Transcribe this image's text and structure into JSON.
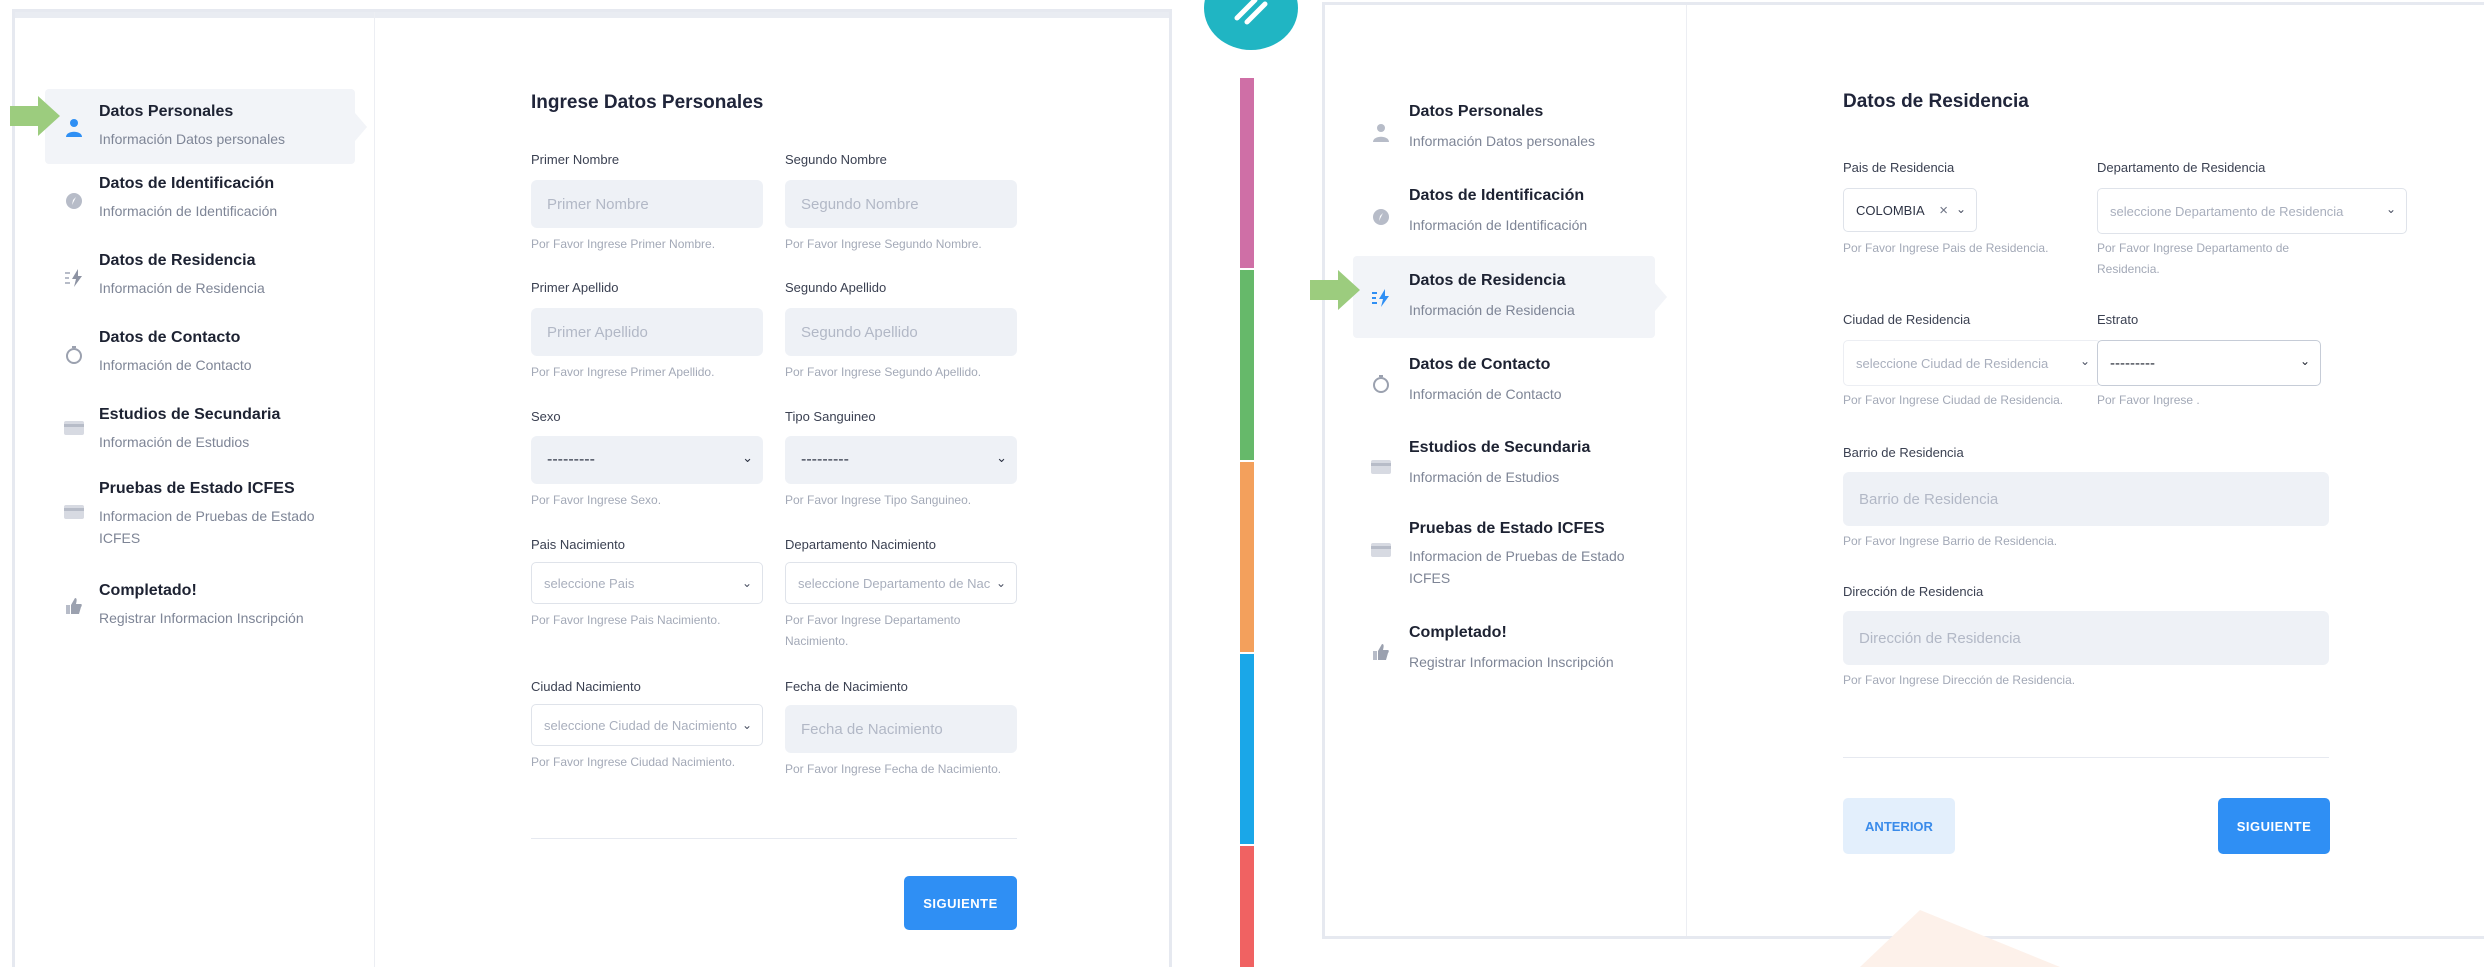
{
  "steps": [
    {
      "title": "Datos Personales",
      "sub": "Información Datos personales",
      "icon": "user-icon"
    },
    {
      "title": "Datos de Identificación",
      "sub": "Información de Identificación",
      "icon": "compass-icon"
    },
    {
      "title": "Datos de Residencia",
      "sub": "Información de Residencia",
      "icon": "bolt-icon"
    },
    {
      "title": "Datos de Contacto",
      "sub": "Información de Contacto",
      "icon": "clock-icon"
    },
    {
      "title": "Estudios de Secundaria",
      "sub": "Información de Estudios",
      "icon": "card-icon"
    },
    {
      "title": "Pruebas de Estado ICFES",
      "sub": "Informacion de Pruebas de Estado ICFES",
      "sub_right_1": "Informacion de Pruebas de Estado",
      "sub_right_2": "ICFES",
      "sub_left_1": "Informacion de Pruebas de Estado",
      "sub_left_2": "ICFES",
      "icon": "card-icon"
    },
    {
      "title": "Completado!",
      "sub": "Registrar Informacion Inscripción",
      "icon": "thumbs-up-icon"
    }
  ],
  "left_form": {
    "title": "Ingrese Datos Personales",
    "primer_nombre": {
      "label": "Primer Nombre",
      "placeholder": "Primer Nombre",
      "hint": "Por Favor Ingrese Primer Nombre."
    },
    "segundo_nombre": {
      "label": "Segundo Nombre",
      "placeholder": "Segundo Nombre",
      "hint": "Por Favor Ingrese Segundo Nombre."
    },
    "primer_apellido": {
      "label": "Primer Apellido",
      "placeholder": "Primer Apellido",
      "hint": "Por Favor Ingrese Primer Apellido."
    },
    "segundo_apellido": {
      "label": "Segundo Apellido",
      "placeholder": "Segundo Apellido",
      "hint": "Por Favor Ingrese Segundo Apellido."
    },
    "sexo": {
      "label": "Sexo",
      "value": "---------",
      "hint": "Por Favor Ingrese Sexo."
    },
    "tipo_sanguineo": {
      "label": "Tipo Sanguineo",
      "value": "---------",
      "hint": "Por Favor Ingrese Tipo Sanguineo."
    },
    "pais_nacimiento": {
      "label": "Pais Nacimiento",
      "value": "seleccione Pais",
      "hint": "Por Favor Ingrese Pais Nacimiento."
    },
    "depto_nacimiento": {
      "label": "Departamento Nacimiento",
      "value": "seleccione Departamento de Nac",
      "hint_1": "Por Favor Ingrese Departamento",
      "hint_2": "Nacimiento."
    },
    "ciudad_nacimiento": {
      "label": "Ciudad Nacimiento",
      "value": "seleccione Ciudad de Nacimiento",
      "hint": "Por Favor Ingrese Ciudad Nacimiento."
    },
    "fecha_nacimiento": {
      "label": "Fecha de Nacimiento",
      "placeholder": "Fecha de Nacimiento",
      "hint": "Por Favor Ingrese Fecha de Nacimiento."
    },
    "next_label": "SIGUIENTE"
  },
  "right_form": {
    "title": "Datos de Residencia",
    "pais": {
      "label": "Pais de Residencia",
      "value": "COLOMBIA",
      "clear": "×",
      "hint": "Por Favor Ingrese Pais de Residencia."
    },
    "depto": {
      "label": "Departamento de Residencia",
      "value": "seleccione Departamento de Residencia",
      "hint_1": "Por Favor Ingrese Departamento de",
      "hint_2": "Residencia."
    },
    "ciudad": {
      "label": "Ciudad de Residencia",
      "value": "seleccione Ciudad de Residencia",
      "hint": "Por Favor Ingrese Ciudad de Residencia."
    },
    "estrato": {
      "label": "Estrato",
      "value": "---------",
      "hint": "Por Favor Ingrese ."
    },
    "barrio": {
      "label": "Barrio de Residencia",
      "placeholder": "Barrio de Residencia",
      "hint": "Por Favor Ingrese Barrio de Residencia."
    },
    "direccion": {
      "label": "Dirección de Residencia",
      "placeholder": "Dirección de Residencia",
      "hint": "Por Favor Ingrese Dirección de Residencia."
    },
    "prev_label": "ANTERIOR",
    "next_label": "SIGUIENTE"
  },
  "colors": {
    "accent": "#2f8ff4",
    "arrow": "#9ccc7e",
    "rainbow": [
      "#cf6fa6",
      "#66b96a",
      "#f3a05c",
      "#1aa7e8",
      "#f06262"
    ]
  }
}
